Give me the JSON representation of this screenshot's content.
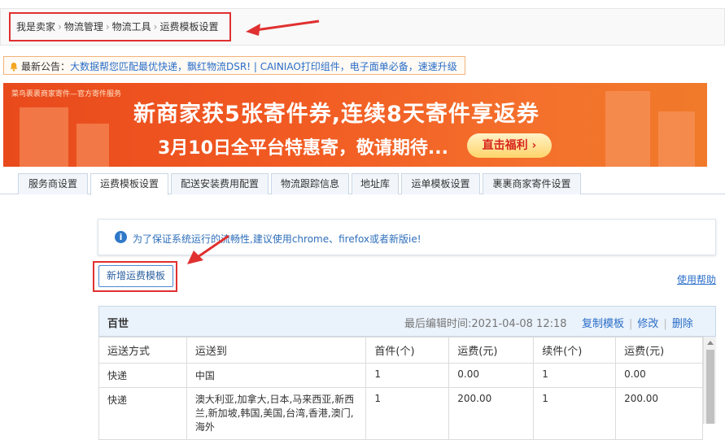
{
  "breadcrumb": {
    "items": [
      "我是卖家",
      "物流管理",
      "物流工具",
      "运费模板设置"
    ]
  },
  "notice": {
    "label": "最新公告：",
    "text": "大数据帮您匹配最优快递，飘红物流DSR! | CAINIAO打印组件，电子面单必备，速速升级"
  },
  "banner": {
    "small_text": "菜鸟裹裹商家寄件—官方寄件服务",
    "headline": "新商家获5张寄件券,连续8天寄件享返券",
    "subline": "3月10日全平台特惠寄，敬请期待...",
    "cta": "直击福利 ›"
  },
  "tabs": [
    {
      "label": "服务商设置"
    },
    {
      "label": "运费模板设置"
    },
    {
      "label": "配送安装费用配置"
    },
    {
      "label": "物流跟踪信息"
    },
    {
      "label": "地址库"
    },
    {
      "label": "运单模板设置"
    },
    {
      "label": "裹裹商家寄件设置"
    }
  ],
  "tip": {
    "text": "为了保证系统运行的流畅性,建议使用chrome、firefox或者新版ie!"
  },
  "actions": {
    "add_template": "新增运费模板",
    "help": "使用帮助"
  },
  "template": {
    "name": "百世",
    "last_edited": "最后编辑时间:2021-04-08 12:18",
    "copy": "复制模板",
    "edit": "修改",
    "delete": "删除",
    "columns": [
      "运送方式",
      "运送到",
      "首件(个)",
      "运费(元)",
      "续件(个)",
      "运费(元)"
    ],
    "rows": [
      [
        "快递",
        "中国",
        "1",
        "0.00",
        "1",
        "0.00"
      ],
      [
        "快递",
        "澳大利亚,加拿大,日本,马来西亚,新西兰,新加坡,韩国,美国,台湾,香港,澳门,海外",
        "1",
        "200.00",
        "1",
        "200.00"
      ]
    ]
  },
  "colors": {
    "highlight_red": "#e03030",
    "link_blue": "#2a6ec8",
    "banner_orange": "#f15a22"
  }
}
